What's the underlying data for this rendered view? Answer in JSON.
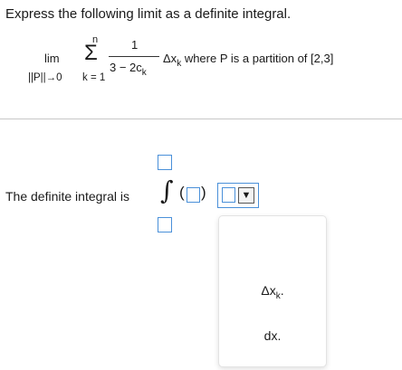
{
  "question": {
    "prompt": "Express the following limit as a definite integral.",
    "limit_word": "lim",
    "limit_subscript": "||P||→0",
    "sum_symbol": "Σ",
    "sum_upper": "n",
    "sum_lower": "k = 1",
    "fraction_numerator": "1",
    "fraction_denominator_main": "3 − 2c",
    "fraction_denominator_sub": "k",
    "delta_x": "Δx",
    "delta_x_sub": "k",
    "condition": "where P is a partition of [2,3]"
  },
  "answer": {
    "label": "The definite integral is",
    "integral_symbol": "∫",
    "paren_open": "(",
    "paren_close": ")",
    "dropdown_arrow": "▼"
  },
  "dropdown_options": [
    {
      "main": "Δx",
      "sub": "k",
      "suffix": "."
    },
    {
      "main": "dx.",
      "sub": "",
      "suffix": ""
    }
  ],
  "colors": {
    "input_border": "#4a90d9",
    "divider": "#c8c8c8"
  }
}
